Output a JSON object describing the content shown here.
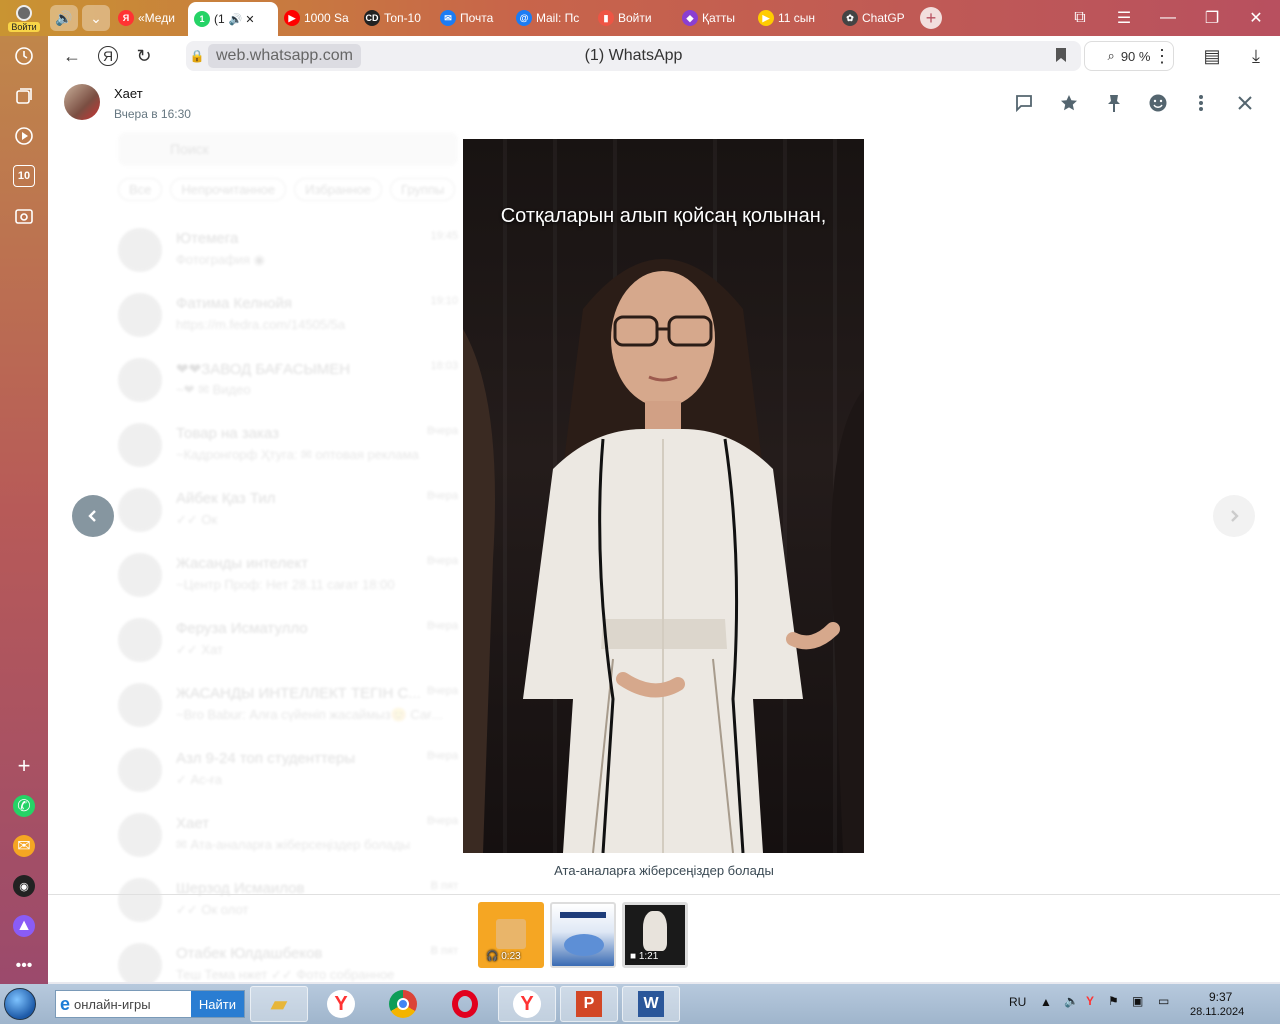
{
  "browser": {
    "profile_label": "Войти",
    "tabs": [
      {
        "label": "«Меди",
        "favicon": "Я",
        "color": "#f33"
      },
      {
        "label": "(1",
        "favicon": "1",
        "color": "#25d366",
        "active": true
      },
      {
        "label": "1000 Sa",
        "favicon": "▶",
        "color": "#f00"
      },
      {
        "label": "Топ-10",
        "favicon": "CD",
        "color": "#222"
      },
      {
        "label": "Почта",
        "favicon": "✉",
        "color": "#1c7cf4"
      },
      {
        "label": "Mail: Пс",
        "favicon": "@",
        "color": "#1c7cf4"
      },
      {
        "label": "Войти",
        "favicon": "▮",
        "color": "#e54"
      },
      {
        "label": "Қатты",
        "favicon": "◆",
        "color": "#8a3fd1"
      },
      {
        "label": "11 сын",
        "favicon": "▶",
        "color": "#fc0"
      },
      {
        "label": "ChatGP",
        "favicon": "✿",
        "color": "#444"
      }
    ],
    "url_domain": "web.whatsapp.com",
    "page_title": "(1) WhatsApp",
    "zoom": "90 %"
  },
  "viewer": {
    "contact_name": "Хает",
    "contact_time": "Вчера в 16:30",
    "subtitle": "Сотқаларын алып қойсаң қолынан,",
    "caption": "Ата-аналарға жіберсеңіздер болады",
    "thumbs": [
      {
        "type": "audio",
        "duration": "0:23",
        "icon": "headphones-icon"
      },
      {
        "type": "image",
        "duration": ""
      },
      {
        "type": "video",
        "duration": "1:21",
        "icon": "video-camera-icon"
      }
    ]
  },
  "background_chats": {
    "search_placeholder": "Поиск",
    "filters": [
      "Все",
      "Непрочитанное",
      "Избранное",
      "Группы"
    ],
    "items": [
      {
        "name": "Ютемега",
        "message": "Фотография ◉",
        "time": "19:45"
      },
      {
        "name": "Фатима Келнойя",
        "message": "https://m.fedra.com/14505/5a",
        "time": "19:10"
      },
      {
        "name": "❤❤ЗАВОД БАҒАСЫМЕН",
        "message": "~❤ ✉ Видео",
        "time": "18:03"
      },
      {
        "name": "Товар на заказ",
        "message": "~Кадронгорф Ҳтуга: ✉ оптовая реклама",
        "time": "Вчера"
      },
      {
        "name": "Айбек Қаз Тил",
        "message": "✓✓ Ок",
        "time": "Вчера"
      },
      {
        "name": "Жасанды интелект",
        "message": "~Центр Проф: Нет 28.11 сағат 18:00",
        "time": "Вчера"
      },
      {
        "name": "Феруза Исматулло",
        "message": "✓✓ Хат",
        "time": "Вчера"
      },
      {
        "name": "ЖАСАНДЫ ИНТЕЛЛЕКТ ТЕГІН С...",
        "message": "~Bro Babur: Алға сүйеніп жасаймыз😊 Сағ...",
        "time": "Вчера"
      },
      {
        "name": "Азл 9-24 топ студенттеры",
        "message": "✓ Ас-ға",
        "time": "Вчера"
      },
      {
        "name": "Хает",
        "message": "✉ Ата-аналарға жіберсеңіздер болады",
        "time": "Вчера"
      },
      {
        "name": "Шерзод Исмаилов",
        "message": "✓✓ Ок олот",
        "time": "В пят"
      },
      {
        "name": "Отабек Юлдашбеков",
        "message": "Теш Тема нжет ✓✓ Фото собранное",
        "time": "В пят"
      }
    ]
  },
  "taskbar": {
    "search_value": "онлайн-игры",
    "search_button": "Найти",
    "lang": "RU",
    "time": "9:37",
    "date": "28.11.2024"
  }
}
